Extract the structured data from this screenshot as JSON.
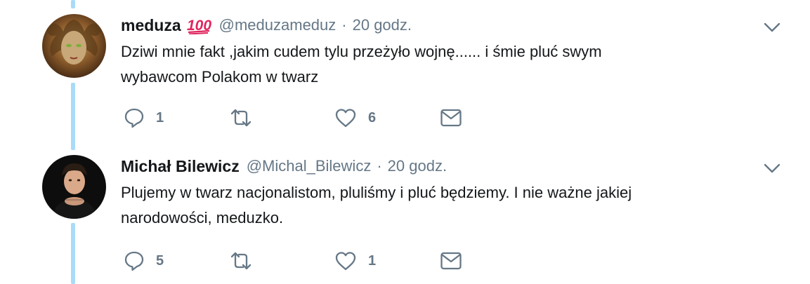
{
  "tweets": [
    {
      "display_name": "meduza",
      "badge_emoji": "100-emoji",
      "handle": "@meduzameduz",
      "separator": "·",
      "time": "20 godz.",
      "text_lines": [
        "Dziwi mnie fakt ,jakim cudem tylu przeżyło wojnę...... i śmie pluć swym",
        "wybawcom Polakom w twarz"
      ],
      "replies": "1",
      "retweets": "",
      "likes": "6"
    },
    {
      "display_name": "Michał Bilewicz",
      "handle": "@Michal_Bilewicz",
      "separator": "·",
      "time": "20 godz.",
      "text_lines": [
        "Plujemy w twarz nacjonalistom, pluliśmy i pluć będziemy. I nie ważne jakiej",
        "narodowości, meduzko."
      ],
      "replies": "5",
      "retweets": "",
      "likes": "1"
    }
  ],
  "colors": {
    "thread_line": "#a8dbf7",
    "secondary_text": "#657786",
    "primary_text": "#14171a",
    "emoji_red": "#e0245e"
  },
  "icons": [
    "reply-icon",
    "retweet-icon",
    "like-icon",
    "direct-message-icon",
    "chevron-down-icon",
    "100-emoji"
  ]
}
